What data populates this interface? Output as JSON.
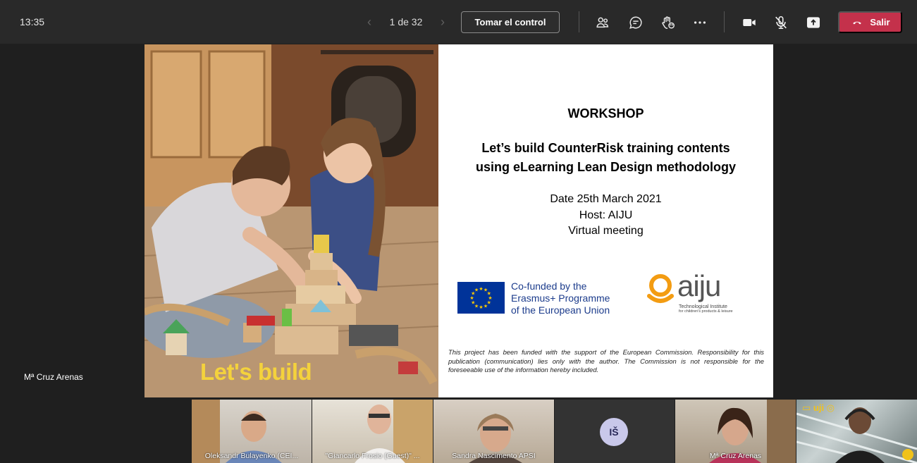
{
  "topbar": {
    "clock": "13:35",
    "page_counter": "1 de 32",
    "prev_icon": "chevron-left-icon",
    "next_icon": "chevron-right-icon",
    "take_control_label": "Tomar el control",
    "leave_label": "Salir",
    "icons": [
      "people-icon",
      "chat-icon",
      "reactions-icon",
      "more-icon",
      "camera-icon",
      "mic-off-icon",
      "share-icon",
      "phone-hangup-icon"
    ]
  },
  "slide": {
    "photo_caption": "Let's build",
    "title": "WORKSHOP",
    "subtitle_line1": "Let’s build CounterRisk training contents",
    "subtitle_line2": "using eLearning Lean Design methodology",
    "date_line": "Date 25th March 2021",
    "host_line": "Host: AIJU",
    "mode_line": "Virtual meeting",
    "eu_line1": "Co-funded by the",
    "eu_line2": "Erasmus+ Programme",
    "eu_line3": "of the European Union",
    "aiju_word": "aiju",
    "aiju_tag_line1": "Technological Institute",
    "aiju_tag_line2": "for children's products & leisure",
    "disclaimer": "This project has been funded with the support of the European Commission. Responsibility for this publication (communication) lies only with the author. The Commission is not responsible for the foreseeable use of the information hereby included."
  },
  "presenter_name": "Mª Cruz Arenas",
  "participants": [
    {
      "name": "Oleksandr Bulayenko (CEI..."
    },
    {
      "name": "\"Giancarlo Frosio (Guest)\" ..."
    },
    {
      "name": "Sandra Nascimento APSI"
    },
    {
      "name": "",
      "initials": "IŠ"
    },
    {
      "name": "Mª Cruz Arenas"
    },
    {
      "name": "",
      "logo": "uji"
    }
  ],
  "colors": {
    "leave_red": "#c4314b",
    "eu_blue": "#003399",
    "eu_star": "#ffcc00",
    "aiju_orange": "#f39c12",
    "caption_yellow": "#f4d23c"
  }
}
